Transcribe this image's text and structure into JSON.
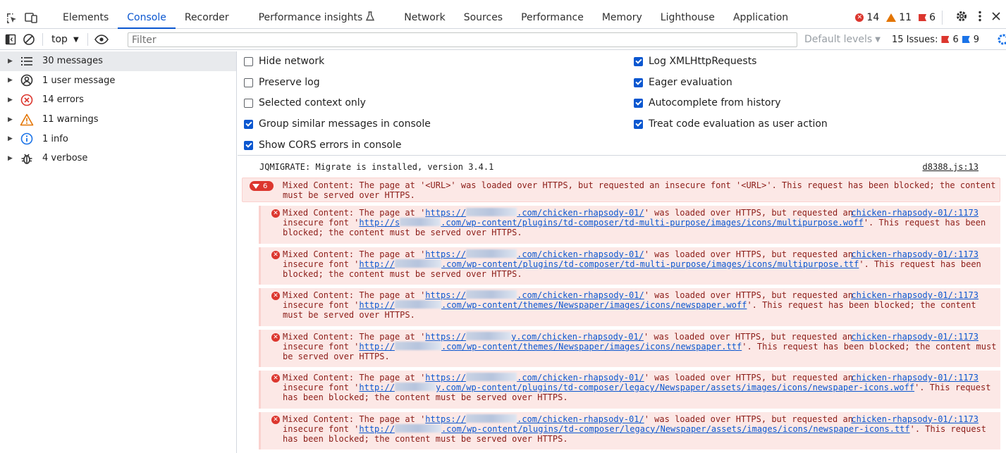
{
  "tabbar": {
    "tabs": [
      {
        "label": "Elements",
        "active": false
      },
      {
        "label": "Console",
        "active": true
      },
      {
        "label": "Recorder",
        "active": false
      },
      {
        "label": "Performance insights",
        "active": false
      },
      {
        "label": "Network",
        "active": false
      },
      {
        "label": "Sources",
        "active": false
      },
      {
        "label": "Performance",
        "active": false
      },
      {
        "label": "Memory",
        "active": false
      },
      {
        "label": "Lighthouse",
        "active": false
      },
      {
        "label": "Application",
        "active": false
      }
    ],
    "counters": {
      "errors": "14",
      "warnings": "11",
      "issues": "6"
    }
  },
  "toolbar": {
    "context": "top",
    "filter_placeholder": "Filter",
    "levels_label": "Default levels",
    "issues_label": "15 Issues:",
    "issues_errors": "6",
    "issues_info": "9"
  },
  "sidebar": {
    "items": [
      {
        "label": "30 messages",
        "icon": "list-icon"
      },
      {
        "label": "1 user message",
        "icon": "user-icon"
      },
      {
        "label": "14 errors",
        "icon": "error-icon"
      },
      {
        "label": "11 warnings",
        "icon": "warning-icon"
      },
      {
        "label": "1 info",
        "icon": "info-icon"
      },
      {
        "label": "4 verbose",
        "icon": "bug-icon"
      }
    ]
  },
  "settings": {
    "left": [
      {
        "label": "Hide network",
        "checked": false
      },
      {
        "label": "Preserve log",
        "checked": false
      },
      {
        "label": "Selected context only",
        "checked": false
      },
      {
        "label": "Group similar messages in console",
        "checked": true
      },
      {
        "label": "Show CORS errors in console",
        "checked": true
      }
    ],
    "right": [
      {
        "label": "Log XMLHttpRequests",
        "checked": true
      },
      {
        "label": "Eager evaluation",
        "checked": true
      },
      {
        "label": "Autocomplete from history",
        "checked": true
      },
      {
        "label": "Treat code evaluation as user action",
        "checked": true
      }
    ]
  },
  "console": {
    "log": {
      "text": "JQMIGRATE: Migrate is installed, version 3.4.1",
      "source": "d8388.js:13"
    },
    "group": {
      "count": "6",
      "line1": "Mixed Content: The page at '<URL>' was loaded over HTTPS, but requested an insecure font '<URL>'. This request has been blocked; the content",
      "line2": "must be served over HTTPS."
    },
    "errors": [
      {
        "source": "chicken-rhapsody-01/:1173",
        "l1_pre": "Mixed Content: The page at '",
        "page_a": "https://",
        "page_b": ".com/chicken-rhapsody-01/",
        "l1_post": "' was loaded over HTTPS, but requested an",
        "l2_pre": "insecure font '",
        "font_a": "http://s",
        "font_b": ".com/wp-content/plugins/td-composer/td-multi-purpose/images/icons/multipurpose.woff",
        "l2_post": "'. This request has been",
        "l3": "blocked; the content must be served over HTTPS."
      },
      {
        "source": "chicken-rhapsody-01/:1173",
        "l1_pre": "Mixed Content: The page at '",
        "page_a": "https://",
        "page_b": ".com/chicken-rhapsody-01/",
        "l1_post": "' was loaded over HTTPS, but requested an",
        "l2_pre": "insecure font '",
        "font_a": "http://",
        "font_b": ".com/wp-content/plugins/td-composer/td-multi-purpose/images/icons/multipurpose.ttf",
        "l2_post": "'. This request has been",
        "l3": "blocked; the content must be served over HTTPS."
      },
      {
        "source": "chicken-rhapsody-01/:1173",
        "l1_pre": "Mixed Content: The page at '",
        "page_a": "https://",
        "page_b": ".com/chicken-rhapsody-01/",
        "l1_post": "' was loaded over HTTPS, but requested an",
        "l2_pre": "insecure font '",
        "font_a": "http://",
        "font_b": ".com/wp-content/themes/Newspaper/images/icons/newspaper.woff",
        "l2_post": "'. This request has been blocked; the content",
        "l3": "must be served over HTTPS."
      },
      {
        "source": "chicken-rhapsody-01/:1173",
        "l1_pre": "Mixed Content: The page at '",
        "page_a": "https://",
        "page_b": "y.com/chicken-rhapsody-01/",
        "l1_post": "' was loaded over HTTPS, but requested an",
        "l2_pre": "insecure font '",
        "font_a": "http://",
        "font_b": ".com/wp-content/themes/Newspaper/images/icons/newspaper.ttf",
        "l2_post": "'. This request has been blocked; the content must",
        "l3": "be served over HTTPS."
      },
      {
        "source": "chicken-rhapsody-01/:1173",
        "l1_pre": "Mixed Content: The page at '",
        "page_a": "https://",
        "page_b": ".com/chicken-rhapsody-01/",
        "l1_post": "' was loaded over HTTPS, but requested an",
        "l2_pre": "insecure font '",
        "font_a": "http://",
        "font_b": "y.com/wp-content/plugins/td-composer/legacy/Newspaper/assets/images/icons/newspaper-icons.woff",
        "l2_post": "'. This request",
        "l3": "has been blocked; the content must be served over HTTPS."
      },
      {
        "source": "chicken-rhapsody-01/:1173",
        "l1_pre": "Mixed Content: The page at '",
        "page_a": "https://",
        "page_b": ".com/chicken-rhapsody-01/",
        "l1_post": "' was loaded over HTTPS, but requested an",
        "l2_pre": "insecure font '",
        "font_a": "http://",
        "font_b": ".com/wp-content/plugins/td-composer/legacy/Newspaper/assets/images/icons/newspaper-icons.ttf",
        "l2_post": "'. This request",
        "l3": "has been blocked; the content must be served over HTTPS."
      }
    ]
  }
}
